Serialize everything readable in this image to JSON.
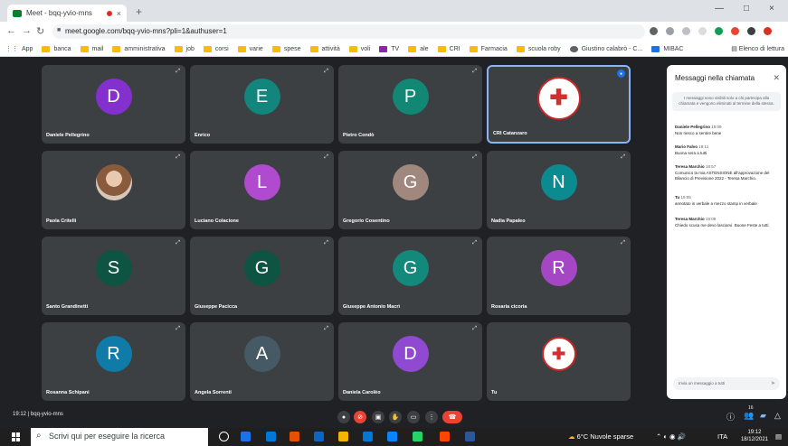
{
  "browser": {
    "tab_title": "Meet - bqq-yvio-mns",
    "tab_close": "×",
    "new_tab": "+",
    "url": "meet.google.com/bqq-yvio-mns?pli=1&authuser=1",
    "win_minimize": "—",
    "win_maximize": "□",
    "win_close": "×"
  },
  "bookmarks": {
    "apps_label": "App",
    "items": [
      "banca",
      "mail",
      "amministrativa",
      "job",
      "corsi",
      "varie",
      "spese",
      "attività",
      "voli",
      "TV",
      "ale",
      "CRI",
      "Farmacia",
      "scuola roby",
      "Giustino calabrò - C...",
      "MIBAC"
    ],
    "reading_list": "Elenco di lettura"
  },
  "participants": [
    {
      "name": "Daniele Pellegrino",
      "initial": "D",
      "color": "#8430ce"
    },
    {
      "name": "Enrico",
      "initial": "E",
      "color": "#12857d"
    },
    {
      "name": "Pietro Condò",
      "initial": "P",
      "color": "#128774"
    },
    {
      "name": "CRI Catanzaro",
      "initial": "",
      "color": "#ffffff"
    },
    {
      "name": "Paola Critelli",
      "initial": "",
      "color": "#8a5a3c"
    },
    {
      "name": "Luciano Colacione",
      "initial": "L",
      "color": "#b04acf"
    },
    {
      "name": "Gregorio Cosentino",
      "initial": "G",
      "color": "#a1887f"
    },
    {
      "name": "Nadia Papaleo",
      "initial": "N",
      "color": "#0b8a8f"
    },
    {
      "name": "Santo Grandinetti",
      "initial": "S",
      "color": "#0d5442"
    },
    {
      "name": "Giuseppe Pacicca",
      "initial": "G",
      "color": "#0d5442"
    },
    {
      "name": "Giuseppe Antonio Macrì",
      "initial": "G",
      "color": "#12897a"
    },
    {
      "name": "Rosaria cicoria",
      "initial": "R",
      "color": "#a547c4"
    },
    {
      "name": "Rosanna Schipani",
      "initial": "R",
      "color": "#0e7ba8"
    },
    {
      "name": "Angela Sorrenti",
      "initial": "A",
      "color": "#455a64"
    },
    {
      "name": "Daniela Carolèo",
      "initial": "D",
      "color": "#8f4ad1"
    },
    {
      "name": "Tu",
      "initial": "",
      "color": "#ffffff"
    }
  ],
  "chat": {
    "title": "Messaggi nella chiamata",
    "notice": "I messaggi sono visibili solo a chi partecipa alla chiamata e vengono eliminati al termine della stessa.",
    "messages": [
      {
        "author": "Daniele Pellegrino",
        "time": "18:09",
        "text": "Non riesco a sentire bene"
      },
      {
        "author": "Mario Falvo",
        "time": "18:11",
        "text": "Buona sera a tutti"
      },
      {
        "author": "Teresa Marchio",
        "time": "18:57",
        "text": "Comunico la mia ASTENSIONE all'approvazione del Bilancio di Previsione 2022 - Teresa Marchio."
      },
      {
        "author": "Tu",
        "time": "19:05",
        "text": "annotato in verbale a mezzo stamp in verbale"
      },
      {
        "author": "Teresa Marchio",
        "time": "19:09",
        "text": "Chiedo scusa me devo lasciarvi. Buone Feste a tutti"
      }
    ],
    "input_placeholder": "Invia un messaggio a tutti"
  },
  "meet": {
    "time_code": "19:12 | bqq-yvio-mns",
    "participant_count": "16"
  },
  "taskbar": {
    "search_placeholder": "Scrivi qui per eseguire la ricerca",
    "weather": "6°C Nuvole sparse",
    "lang": "ITA",
    "time": "19:12",
    "date": "18/12/2021"
  }
}
